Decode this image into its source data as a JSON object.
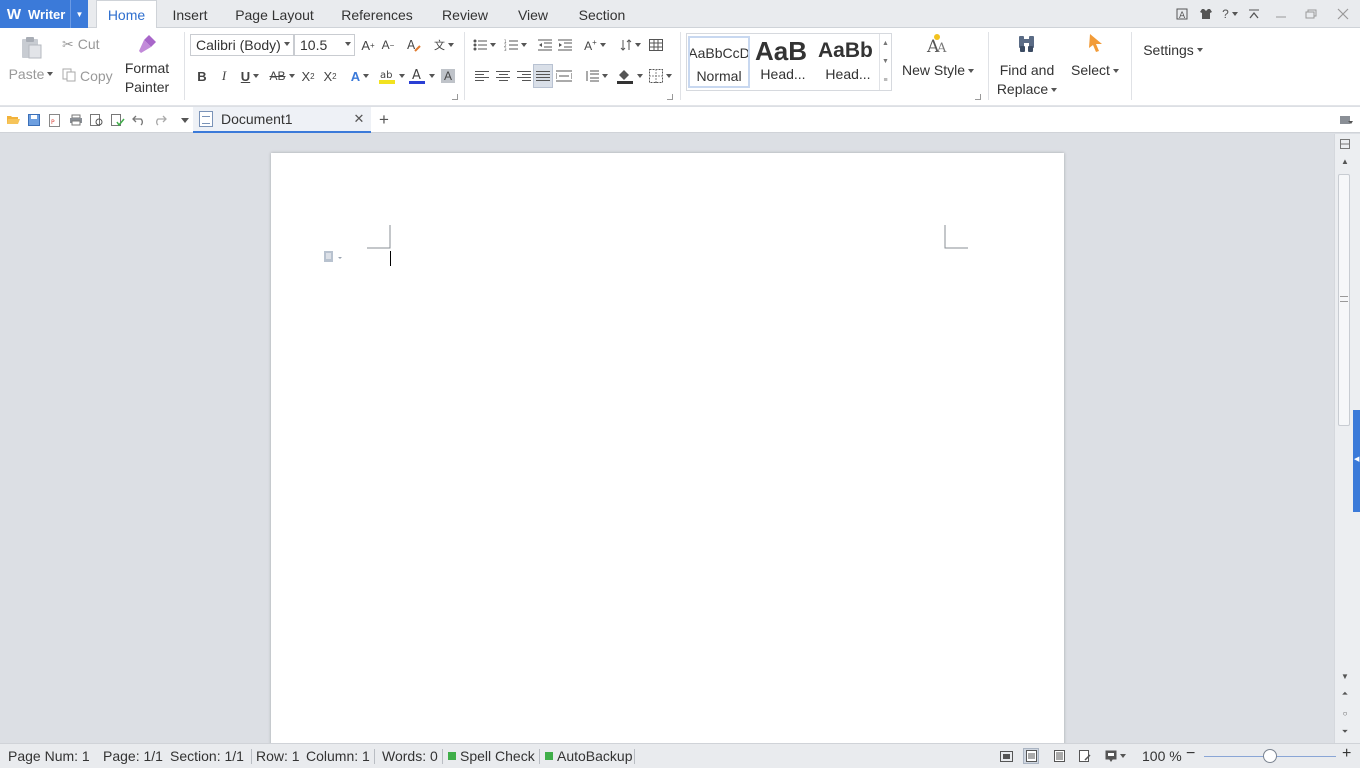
{
  "app": {
    "name": "Writer"
  },
  "menu_tabs": [
    "Home",
    "Insert",
    "Page Layout",
    "References",
    "Review",
    "View",
    "Section"
  ],
  "active_tab": "Home",
  "clipboard": {
    "paste": "Paste",
    "cut": "Cut",
    "copy": "Copy",
    "format_painter_line1": "Format",
    "format_painter_line2": "Painter"
  },
  "font": {
    "name": "Calibri (Body)",
    "size": "10.5"
  },
  "styles": {
    "items": [
      {
        "preview": "AaBbCcD",
        "name": "Normal"
      },
      {
        "preview": "AaB",
        "name": "Head..."
      },
      {
        "preview": "AaBb",
        "name": "Head..."
      }
    ],
    "new_style": "New Style"
  },
  "editing": {
    "find_line1": "Find and",
    "find_line2": "Replace",
    "select": "Select"
  },
  "settings": "Settings",
  "document_tab": {
    "name": "Document1"
  },
  "status": {
    "page_num": "Page Num: 1",
    "page": "Page: 1/1",
    "section": "Section: 1/1",
    "row": "Row: 1",
    "column": "Column: 1",
    "words": "Words: 0",
    "spell_check": "Spell Check",
    "autobackup": "AutoBackup",
    "zoom": "100 %"
  },
  "colors": {
    "accent": "#3b7ad9",
    "font_color": "#2a3fd4",
    "highlight": "#f2e21f",
    "status_green": "#3fae49"
  }
}
